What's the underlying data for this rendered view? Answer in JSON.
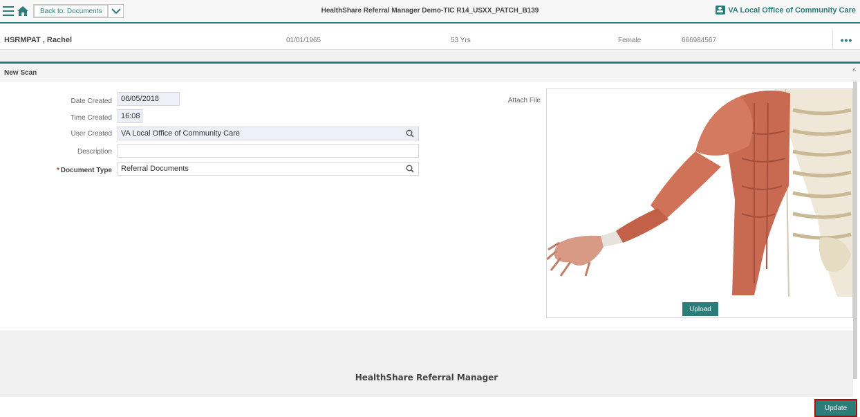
{
  "topbar": {
    "back_label": "Back to: Documents",
    "app_title": "HealthShare Referral Manager Demo-TIC R14_USXX_PATCH_B139",
    "org_label": "VA Local Office of Community Care"
  },
  "patient": {
    "name": "HSRMPAT , Rachel",
    "dob": "01/01/1965",
    "age": "53 Yrs",
    "gender": "Female",
    "id": "666984567"
  },
  "section": {
    "title": "New Scan",
    "collapse_glyph": "^"
  },
  "form": {
    "date_created_label": "Date Created",
    "date_created_value": "06/05/2018",
    "time_created_label": "Time Created",
    "time_created_value": "16:08",
    "user_created_label": "User Created",
    "user_created_value": "VA Local Office of Community Care",
    "description_label": "Description",
    "description_value": "",
    "document_type_label": "Document Type",
    "document_type_value": "Referral Documents",
    "attach_file_label": "Attach File"
  },
  "buttons": {
    "upload": "Upload",
    "update": "Update"
  },
  "footer": {
    "text": "HealthShare Referral Manager"
  },
  "colors": {
    "accent": "#2b7d7a",
    "highlight_border": "#c00000",
    "required": "#c0392b"
  }
}
